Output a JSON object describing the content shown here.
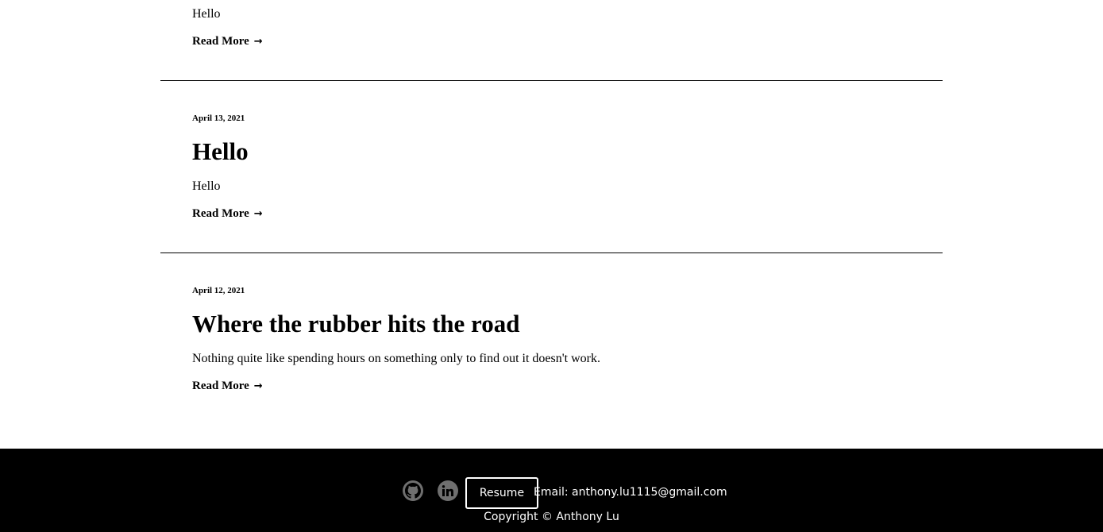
{
  "posts": [
    {
      "date": "",
      "title": "",
      "excerpt": "Hello",
      "read_more": "Read More"
    },
    {
      "date": "April 13, 2021",
      "title": "Hello",
      "excerpt": "Hello",
      "read_more": "Read More"
    },
    {
      "date": "April 12, 2021",
      "title": "Where the rubber hits the road",
      "excerpt": "Nothing quite like spending hours on something only to find out it doesn't work.",
      "read_more": "Read More"
    }
  ],
  "read_more_arrow": "→",
  "footer": {
    "icons": [
      "github-icon",
      "linkedin-icon"
    ],
    "resume_label": "Resume",
    "email": "Email: anthony.lu1115@gmail.com",
    "copyright": "Copyright © Anthony Lu"
  },
  "colors": {
    "background": "#ffffff",
    "footer_background": "#000000",
    "icon_fill": "#6f6f6f"
  }
}
